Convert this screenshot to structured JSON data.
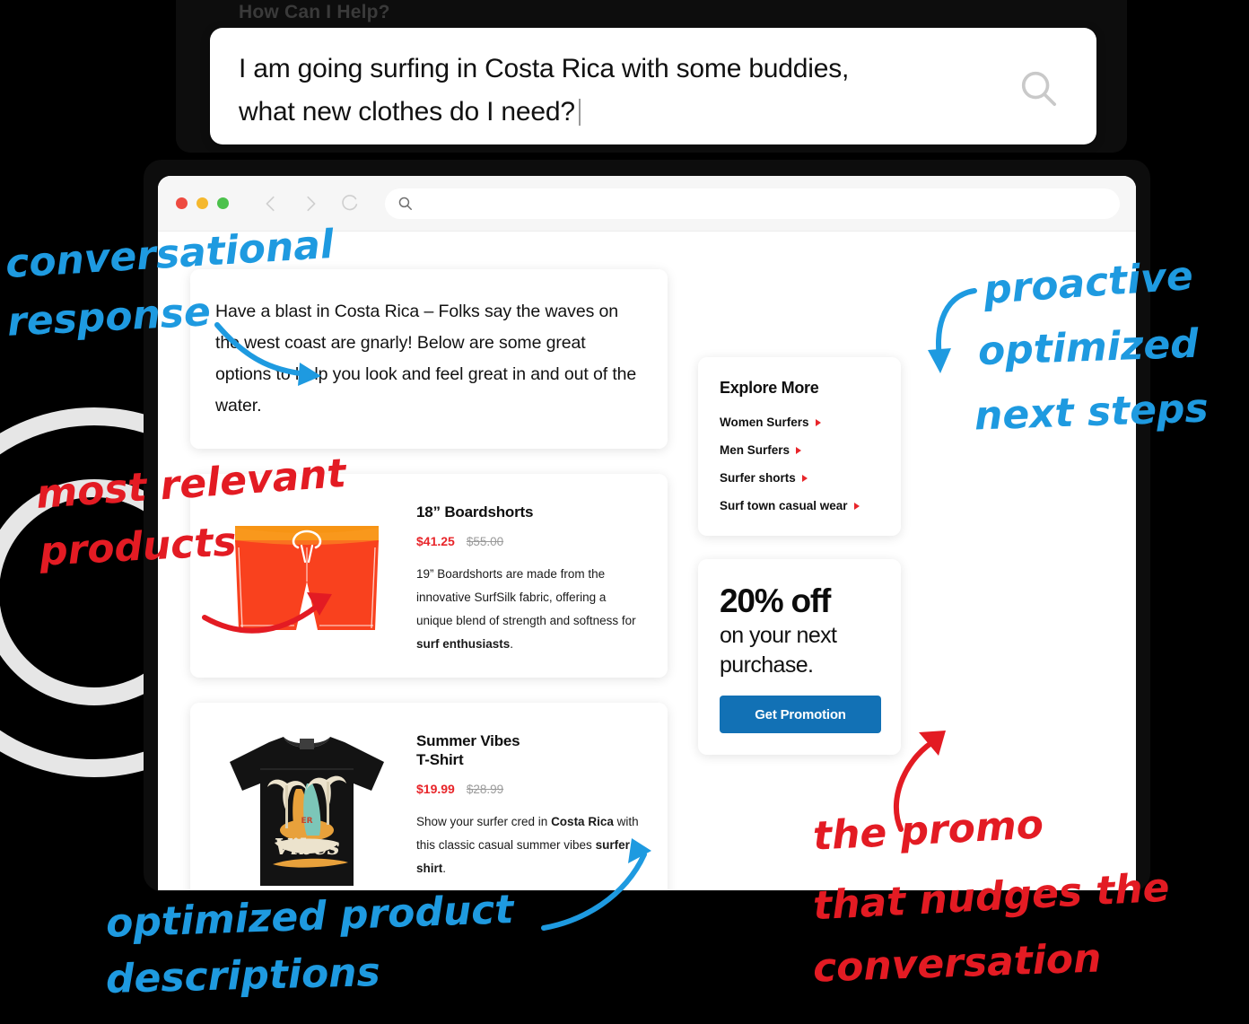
{
  "search_panel": {
    "title": "How Can I Help?",
    "query_line1": "I am going surfing in Costa Rica with some buddies,",
    "query_line2": "what new clothes do I need?",
    "search_icon": "search-icon"
  },
  "browser": {
    "traffic_lights": [
      "close",
      "minimize",
      "maximize"
    ],
    "back_icon": "chevron-left-icon",
    "forward_icon": "chevron-right-icon",
    "reload_icon": "reload-icon",
    "address_icon": "search-icon",
    "address_value": "",
    "address_placeholder": ""
  },
  "response": {
    "text": "Have a blast in Costa Rica – Folks say the waves on the west coast are gnarly! Below are some great options to help you look and feel great in and out of the water."
  },
  "products": [
    {
      "image_name": "boardshorts-image",
      "title": "18” Boardshorts",
      "price_sale": "$41.25",
      "price_original": "$55.00",
      "desc_pre": "19” Boardshorts are made from the innovative SurfSilk fabric, offering a unique blend of strength and softness for ",
      "desc_bold": "surf enthusiasts",
      "desc_post": "."
    },
    {
      "image_name": "tshirt-image",
      "title": "Summer Vibes\nT-Shirt",
      "price_sale": "$19.99",
      "price_original": "$28.99",
      "desc_pre": "Show your surfer cred in ",
      "desc_bold": "Costa Rica",
      "desc_mid": " with this classic casual summer vibes ",
      "desc_bold2": "surfer shirt",
      "desc_post": "."
    }
  ],
  "explore": {
    "title": "Explore More",
    "links": [
      "Women Surfers",
      "Men Surfers",
      "Surfer shorts",
      "Surf town casual wear"
    ]
  },
  "promo": {
    "headline": "20% off",
    "subline_1": "on your next",
    "subline_2": "purchase.",
    "button_label": "Get Promotion"
  },
  "annotations": {
    "conversational_l1": "conversational",
    "conversational_l2": "response",
    "relevant_l1": "most relevant",
    "relevant_l2": "products",
    "proactive_l1": "proactive",
    "proactive_l2": "optimized",
    "proactive_l3": "next steps",
    "descriptions_l1": "optimized product",
    "descriptions_l2": "descriptions",
    "promo_l1": "the promo",
    "promo_l2": "that nudges the",
    "promo_l3": "conversation"
  },
  "colors": {
    "accent_blue": "#1271b5",
    "annotation_blue": "#1e9ae0",
    "sale_red": "#e8252a",
    "annotation_red": "#e31b23",
    "shorts_orange": "#f9411e",
    "shorts_waistband": "#f79414"
  }
}
